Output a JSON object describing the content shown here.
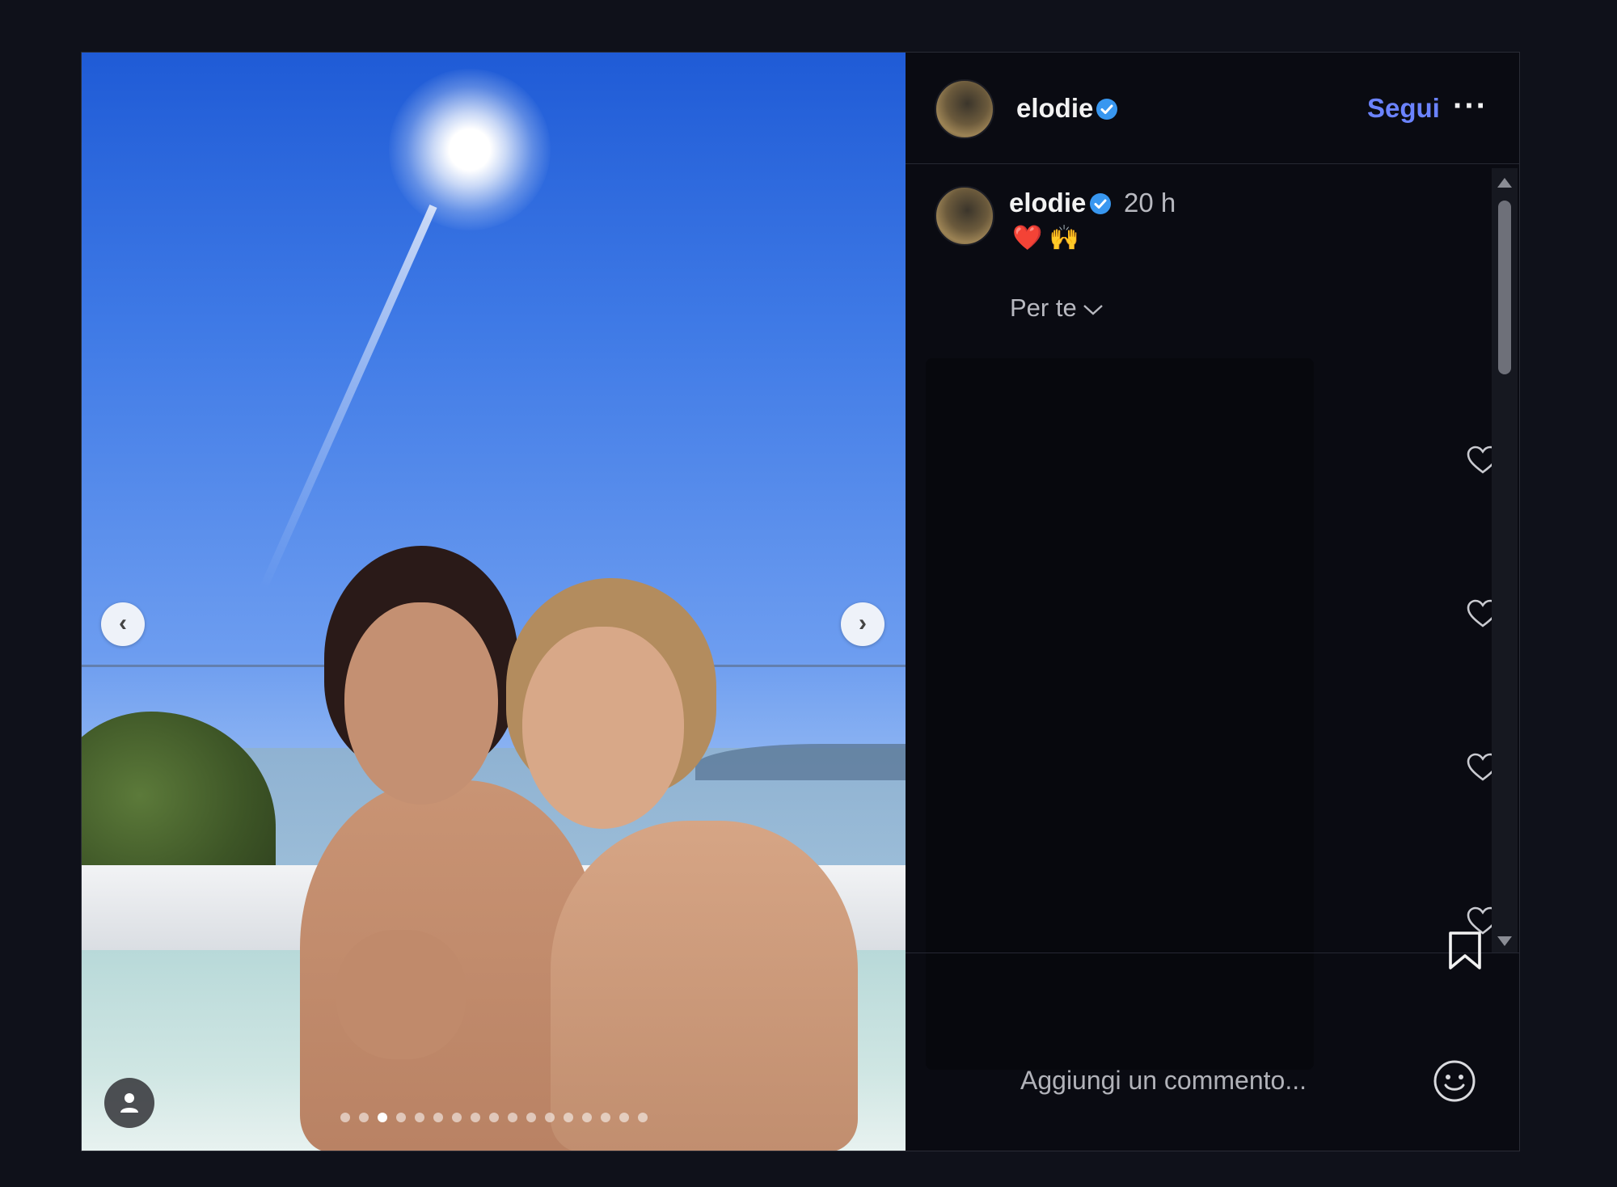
{
  "post": {
    "author": {
      "username": "elodie",
      "verified": true
    },
    "header": {
      "follow_label": "Segui",
      "more_label": "···"
    },
    "caption": {
      "time_ago": "20 h",
      "emojis": "❤️ 🙌"
    },
    "comments": {
      "sort_label": "Per te",
      "visible_like_icons": 4
    },
    "carousel": {
      "total_slides": 17,
      "active_slide": 3
    },
    "comment_box": {
      "placeholder": "Aggiungi un commento..."
    }
  },
  "icons": {
    "prev": "chevron-left-icon",
    "next": "chevron-right-icon",
    "tag": "user-icon",
    "verified": "verified-badge-icon",
    "like": "heart-outline-icon",
    "save": "bookmark-icon",
    "emoji": "smiley-icon",
    "sort": "chevron-down-icon"
  },
  "colors": {
    "background": "#0f111a",
    "panel": "#0a0b12",
    "accent": "#6b83ff",
    "verified": "#3897f0"
  }
}
